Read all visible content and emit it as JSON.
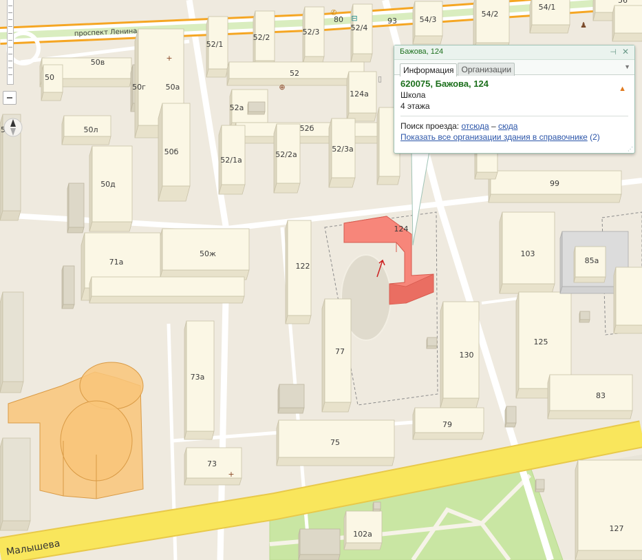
{
  "map": {
    "streets": [
      {
        "id": "lenina",
        "name": "проспект Ленина"
      },
      {
        "id": "malysheva",
        "name": "Малышева"
      }
    ],
    "buildings": [
      {
        "id": "b56",
        "label": "56"
      },
      {
        "id": "b54-1",
        "label": "54/1"
      },
      {
        "id": "b54-2",
        "label": "54/2"
      },
      {
        "id": "b54-3",
        "label": "54/3"
      },
      {
        "id": "b93",
        "label": "93"
      },
      {
        "id": "b80",
        "label": "80"
      },
      {
        "id": "b52-4",
        "label": "52/4"
      },
      {
        "id": "b52-3",
        "label": "52/3"
      },
      {
        "id": "b52-2",
        "label": "52/2"
      },
      {
        "id": "b52-1",
        "label": "52/1"
      },
      {
        "id": "b52",
        "label": "52"
      },
      {
        "id": "b52a",
        "label": "52а"
      },
      {
        "id": "b124a",
        "label": "124а"
      },
      {
        "id": "b52b",
        "label": "52б"
      },
      {
        "id": "b52-1a",
        "label": "52/1а"
      },
      {
        "id": "b52-2a",
        "label": "52/2а"
      },
      {
        "id": "b52-3a",
        "label": "52/3а"
      },
      {
        "id": "b50v",
        "label": "50в"
      },
      {
        "id": "b50",
        "label": "50"
      },
      {
        "id": "b50g",
        "label": "50г"
      },
      {
        "id": "b50a",
        "label": "50а"
      },
      {
        "id": "b50l",
        "label": "50л"
      },
      {
        "id": "b50b",
        "label": "50б"
      },
      {
        "id": "b50d",
        "label": "50д"
      },
      {
        "id": "b50zh",
        "label": "50ж"
      },
      {
        "id": "b71a",
        "label": "71а"
      },
      {
        "id": "b50-edge",
        "label": "50"
      },
      {
        "id": "b124",
        "label": "124"
      },
      {
        "id": "b122",
        "label": "122"
      },
      {
        "id": "b77",
        "label": "77"
      },
      {
        "id": "b130",
        "label": "130"
      },
      {
        "id": "b99",
        "label": "99"
      },
      {
        "id": "b103",
        "label": "103"
      },
      {
        "id": "b85a",
        "label": "85а"
      },
      {
        "id": "b125",
        "label": "125"
      },
      {
        "id": "b83",
        "label": "83"
      },
      {
        "id": "b79",
        "label": "79"
      },
      {
        "id": "b75",
        "label": "75"
      },
      {
        "id": "b73a",
        "label": "73а"
      },
      {
        "id": "b73",
        "label": "73"
      },
      {
        "id": "b102a",
        "label": "102а"
      },
      {
        "id": "b127",
        "label": "127"
      }
    ]
  },
  "popup": {
    "title": "Бажова, 124",
    "tabs": [
      "Информация",
      "Организации"
    ],
    "active_tab": "Информация",
    "address": "620075, Бажова, 124",
    "type": "Школа",
    "floors": "4 этажа",
    "route_label": "Поиск проезда:",
    "route_from": "отсюда",
    "route_separator": "–",
    "route_to": "сюда",
    "orgs_link": "Показать все организации здания в справочнике",
    "orgs_count": "(2)"
  },
  "colors": {
    "selected_building": "#f7867a",
    "highlight_building": "#f9c57a",
    "main_road": "#f9e65c",
    "avenue_border": "#f5a623",
    "park": "#c9e6a3",
    "link": "#2a54a8",
    "popup_accent": "#1c6f1c"
  },
  "icons": {
    "zoom": "zoom-slider",
    "zoom_out": "minus-icon",
    "compass": "compass-icon",
    "pin": "pin-icon",
    "close": "close-icon",
    "warning": "warning-icon"
  }
}
